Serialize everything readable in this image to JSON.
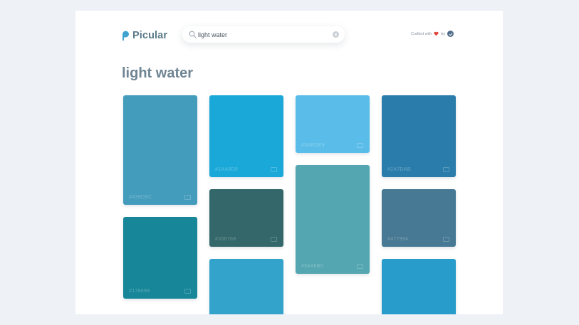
{
  "app": {
    "name": "Picular"
  },
  "search": {
    "value": "light water"
  },
  "credit": {
    "text": "Crafted with",
    "by": "by"
  },
  "title": "light water",
  "cards": [
    {
      "hex": "#439CBC",
      "color": "#439cbc"
    },
    {
      "hex": "#178699",
      "color": "#178699"
    },
    {
      "hex": "#1AA8D8",
      "color": "#1aa8d8"
    },
    {
      "hex": "#336769",
      "color": "#336769"
    },
    {
      "hex": "",
      "color": "#34a3cc"
    },
    {
      "hex": "#5ABDE9",
      "color": "#5abde9"
    },
    {
      "hex": "#54A6B0",
      "color": "#54a6b0"
    },
    {
      "hex": "#2A7DAB",
      "color": "#2a7dab"
    },
    {
      "hex": "#477994",
      "color": "#477994"
    },
    {
      "hex": "",
      "color": "#289ccb"
    }
  ]
}
